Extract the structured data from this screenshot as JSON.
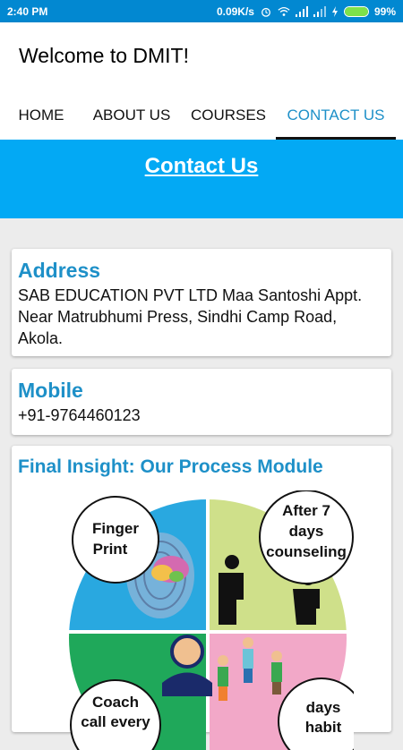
{
  "status_bar": {
    "time": "2:40 PM",
    "network_speed": "0.09K/s",
    "battery_percent": "99%",
    "battery_level": 0.99,
    "icons": [
      "alarm-icon",
      "wifi-icon",
      "signal-icon",
      "signal-icon",
      "charging-icon",
      "battery-icon"
    ]
  },
  "app": {
    "title": "Welcome to DMIT!"
  },
  "tabs": [
    {
      "label": "HOME",
      "active": false
    },
    {
      "label": "ABOUT US",
      "active": false
    },
    {
      "label": "COURSES",
      "active": false
    },
    {
      "label": "CONTACT US",
      "active": true
    }
  ],
  "hero": {
    "title": "Contact Us"
  },
  "address": {
    "heading": "Address",
    "text": "SAB EDUCATION PVT LTD Maa Santoshi Appt. Near Matrubhumi Press, Sindhi Camp Road, Akola."
  },
  "mobile": {
    "heading": "Mobile",
    "number": "+91-9764460123"
  },
  "process": {
    "heading": "Final Insight: Our Process Module",
    "steps": [
      {
        "label_line1": "Finger",
        "label_line2": "Print",
        "color": "#29a8e0"
      },
      {
        "label_line1": "After 7",
        "label_line2": "days",
        "label_line3": "counseling",
        "color": "#cfe08a"
      },
      {
        "label_line1": "Coach",
        "label_line2": "call every",
        "color": "#1fa85a"
      },
      {
        "label_line1": "days",
        "label_line2": "habit",
        "color": "#f2a8c8"
      }
    ]
  },
  "colors": {
    "accent": "#1e90c8",
    "hero_bg": "#03a9f4",
    "status_bg": "#0288d1"
  }
}
